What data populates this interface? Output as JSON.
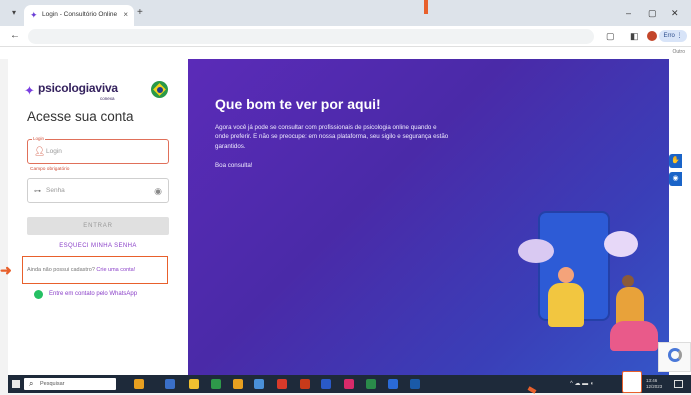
{
  "browser": {
    "tab_title": "Login - Consultório Online",
    "tab_close": "×",
    "new_tab": "+",
    "window_controls": [
      "–",
      "▢",
      "✕"
    ],
    "back": "←",
    "profile_pill": "Erro ⋮",
    "bookmarks_right": "Outro"
  },
  "login": {
    "logo_text": "psicologiaviva",
    "logo_sub": "conexa",
    "heading": "Acesse sua conta",
    "login_legend": "Login",
    "login_placeholder": "Login",
    "login_error": "Campo obrigatório",
    "password_placeholder": "Senha",
    "submit_label": "ENTRAR",
    "forgot_password": "ESQUECI MINHA SENHA",
    "signup_prompt": "Ainda não possui cadastro?",
    "signup_link": "Crie uma conta!",
    "whatsapp_link": "Entre em contato pelo WhatsApp"
  },
  "hero": {
    "title": "Que bom te ver por aqui!",
    "description": "Agora você já pode se consultar com profissionais de psicologia online quando e onde preferir. E não se preocupe: em nossa plataforma, seu sigilo e segurança estão garantidos.",
    "closing": "Boa consulta!"
  },
  "taskbar": {
    "search_placeholder": "Pesquisar",
    "clock_time": "13:46",
    "clock_date": "12/2023"
  },
  "colors": {
    "brand_purple": "#7a3fe0",
    "error_red": "#d0503a",
    "annotation_orange": "#e8602c",
    "whatsapp_green": "#25c063"
  },
  "icons": {
    "tab_favicon": "psicologiaviva-logo-icon",
    "flag": "brazil-flag-icon",
    "login_field": "user-icon",
    "password_field": "key-icon",
    "password_toggle": "eye-icon",
    "whatsapp": "whatsapp-icon",
    "accessibility_1": "sign-language-icon",
    "accessibility_2": "eye-icon"
  }
}
